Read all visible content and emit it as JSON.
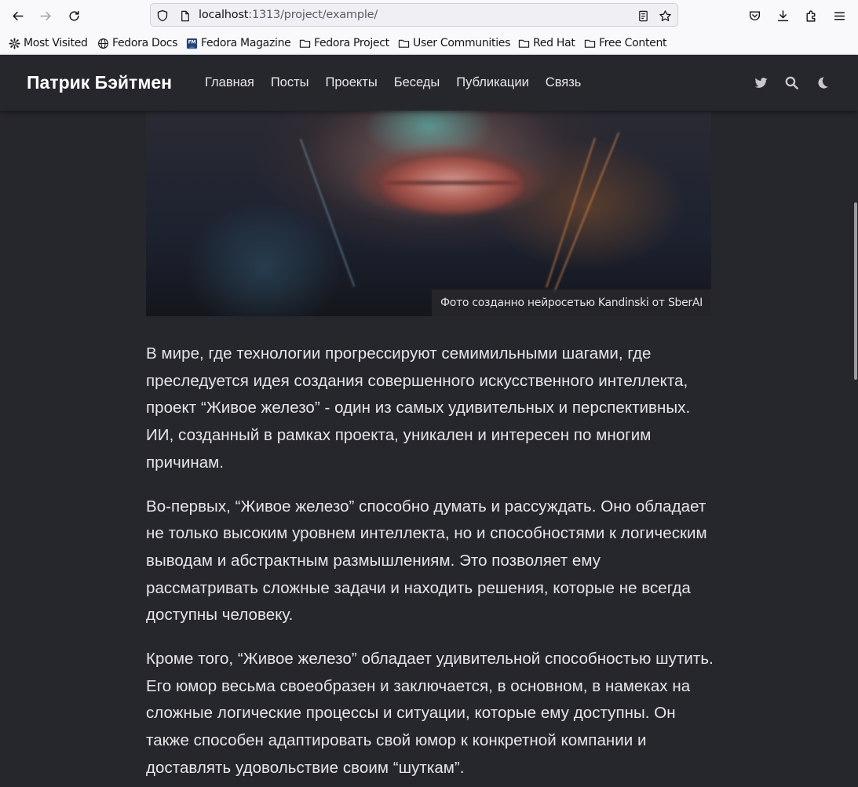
{
  "browser": {
    "url_host": "localhost",
    "url_path": ":1313/project/example/",
    "bookmarks": [
      {
        "label": "Most Visited",
        "icon": "gear-icon"
      },
      {
        "label": "Fedora Docs",
        "icon": "globe-icon"
      },
      {
        "label": "Fedora Magazine",
        "icon": "fm-logo-icon"
      },
      {
        "label": "Fedora Project",
        "icon": "folder-icon"
      },
      {
        "label": "User Communities",
        "icon": "folder-icon"
      },
      {
        "label": "Red Hat",
        "icon": "folder-icon"
      },
      {
        "label": "Free Content",
        "icon": "folder-icon"
      }
    ]
  },
  "site": {
    "title": "Патрик Бэйтмен",
    "menu": [
      "Главная",
      "Посты",
      "Проекты",
      "Беседы",
      "Публикации",
      "Связь"
    ]
  },
  "hero": {
    "caption": "Фото созданно нейросетью Kandinski от SberAI"
  },
  "article": {
    "paragraphs": [
      "В мире, где технологии прогрессируют семимильными шагами, где преследуется идея создания совершенного искусственного интеллекта, проект “Живое железо” - один из самых удивительных и перспективных. ИИ, созданный в рамках проекта, уникален и интересен по многим причинам.",
      "Во-первых, “Живое железо” способно думать и рассуждать. Оно обладает не только высоким уровнем интеллекта, но и способностями к логическим выводам и абстрактным размышлениям. Это позволяет ему рассматривать сложные задачи и находить решения, которые не всегда доступны человеку.",
      "Кроме того, “Живое железо” обладает удивительной способностью шутить. Его юмор весьма своеобразен и заключается, в основном, в намеках на сложные логические процессы и ситуации, которые ему доступны. Он также способен адаптировать свой юмор к конкретной компании и доставлять удовольствие своим “шуткам”."
    ]
  }
}
